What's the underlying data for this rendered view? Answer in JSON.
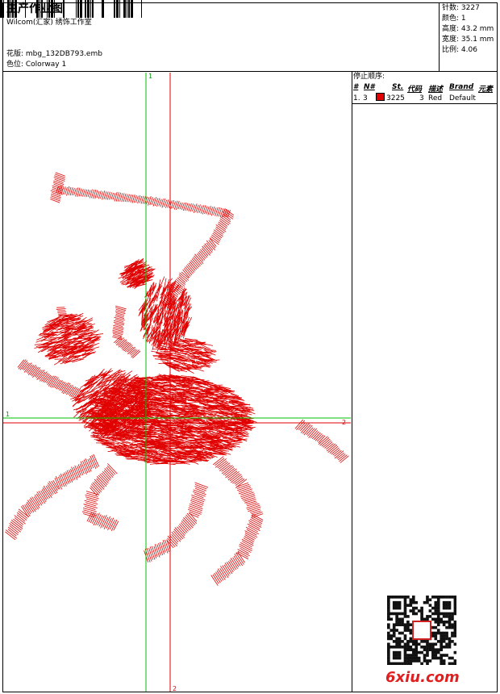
{
  "header": {
    "title": "生产作业图",
    "subtitle": "Wilcom(汇家) 绣饰工作室",
    "design_label": "花版: mbg_132DB793.emb",
    "colorway_label": "色位: Colorway 1"
  },
  "stats": [
    {
      "label": "针数: 3227"
    },
    {
      "label": "颜色: 1"
    },
    {
      "label": "高度: 43.2 mm"
    },
    {
      "label": "宽度: 35.1 mm"
    },
    {
      "label": "比例: 4.06"
    }
  ],
  "sequence": {
    "title": "停止顺序:",
    "headers": [
      "#",
      "N#",
      "St.",
      "代码",
      "描述",
      "Brand",
      "元素"
    ],
    "row": {
      "index": "1.",
      "needle": "3",
      "stitches": "3225",
      "code": "3",
      "desc": "Red",
      "brand": "Default"
    }
  },
  "crosshair": {
    "green_left": "1",
    "green_right": "2",
    "red_top": "1",
    "red_bottom": "2"
  },
  "colors": {
    "stitch": "#e00000",
    "guide_green": "#00c000",
    "guide_red": "#e00000"
  },
  "footer": {
    "watermark": "6xiu.com"
  },
  "icons": {
    "qr": "qr-code-icon",
    "barcode": "barcode-icon"
  }
}
